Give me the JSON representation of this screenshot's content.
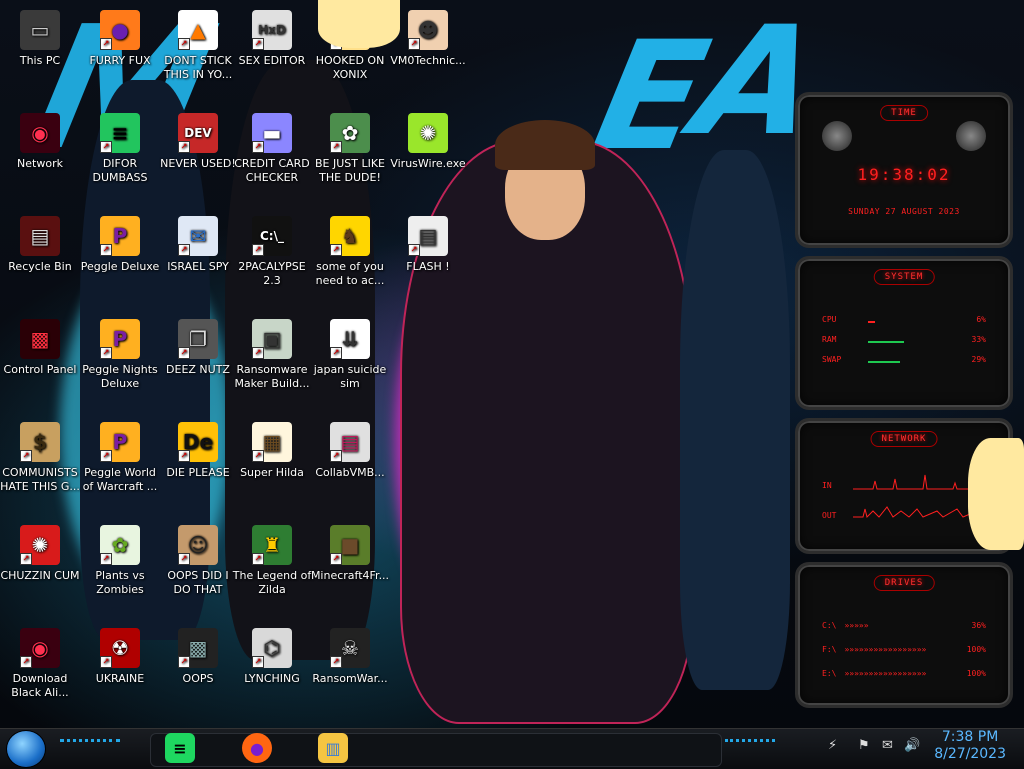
{
  "desktop": {
    "icons": [
      {
        "label": "This PC",
        "glyph": "▭",
        "color": "#3a3a3a",
        "fg": "#ccc",
        "shortcut": false
      },
      {
        "label": "FURRY FUX",
        "glyph": "●",
        "color": "#ff7a1a",
        "fg": "#6a1fb0",
        "shortcut": true
      },
      {
        "label": "DONT STICK THIS IN YO...",
        "glyph": "▲",
        "color": "#ffffff",
        "fg": "#ff7a00",
        "shortcut": true
      },
      {
        "label": "SEX EDITOR",
        "glyph": "HxD",
        "color": "#e0e0e0",
        "fg": "#333",
        "shortcut": true
      },
      {
        "label": "HOOKED ON XONIX",
        "glyph": "☺",
        "color": "#ffe08a",
        "fg": "#333",
        "shortcut": true
      },
      {
        "label": "VM0Technic...",
        "glyph": "☻",
        "color": "#f0d0b0",
        "fg": "#333",
        "shortcut": true
      },
      {
        "label": "Network",
        "glyph": "◉",
        "color": "#3a0010",
        "fg": "#ff3050",
        "shortcut": false
      },
      {
        "label": "DIFOR DUMBASS",
        "glyph": "≡",
        "color": "#22c55e",
        "fg": "#000",
        "shortcut": true
      },
      {
        "label": "NEVER USED!",
        "glyph": "DEV",
        "color": "#c62828",
        "fg": "#fff",
        "shortcut": true
      },
      {
        "label": "CREDIT CARD CHECKER",
        "glyph": "▬",
        "color": "#8b86ff",
        "fg": "#fff",
        "shortcut": true
      },
      {
        "label": "BE JUST LIKE THE DUDE!",
        "glyph": "✿",
        "color": "#4c8e4c",
        "fg": "#fff",
        "shortcut": true
      },
      {
        "label": "VirusWire.exe",
        "glyph": "✺",
        "color": "#9ae62b",
        "fg": "#fff",
        "shortcut": false
      },
      {
        "label": "Recycle Bin",
        "glyph": "▤",
        "color": "#5a1010",
        "fg": "#ddd",
        "shortcut": false
      },
      {
        "label": "Peggle Deluxe",
        "glyph": "P",
        "color": "#ffb020",
        "fg": "#7b1fa2",
        "shortcut": true
      },
      {
        "label": "ISRAEL SPY",
        "glyph": "✉",
        "color": "#dfe8f5",
        "fg": "#2a6ec8",
        "shortcut": true
      },
      {
        "label": "2PACALYPSE 2.3",
        "glyph": "C:\\_",
        "color": "#111",
        "fg": "#fff",
        "shortcut": true
      },
      {
        "label": "some of you need to ac...",
        "glyph": "♞",
        "color": "#ffd600",
        "fg": "#5d3a1a",
        "shortcut": true
      },
      {
        "label": "FLASH !",
        "glyph": "▤",
        "color": "#eeeeee",
        "fg": "#333",
        "shortcut": true
      },
      {
        "label": "Control Panel",
        "glyph": "▩",
        "color": "#2a0006",
        "fg": "#ff3040",
        "shortcut": false
      },
      {
        "label": "Peggle Nights Deluxe",
        "glyph": "P",
        "color": "#ffb020",
        "fg": "#7b1fa2",
        "shortcut": true
      },
      {
        "label": "DEEZ NUTZ",
        "glyph": "❐",
        "color": "#555",
        "fg": "#ddd",
        "shortcut": true
      },
      {
        "label": "Ransomware Maker Build...",
        "glyph": "▣",
        "color": "#c8d6c8",
        "fg": "#333",
        "shortcut": true
      },
      {
        "label": "japan suicide sim",
        "glyph": "⇊",
        "color": "#ffffff",
        "fg": "#333",
        "shortcut": true
      },
      {
        "label": "COMMUNISTS HATE THIS G...",
        "glyph": "$",
        "color": "#c8a060",
        "fg": "#3a2a10",
        "shortcut": true
      },
      {
        "label": "Peggle World of Warcraft ...",
        "glyph": "P",
        "color": "#ffb020",
        "fg": "#7b1fa2",
        "shortcut": true
      },
      {
        "label": "DIE PLEASE",
        "glyph": "De",
        "color": "#ffc107",
        "fg": "#111",
        "shortcut": true
      },
      {
        "label": "Super Hilda",
        "glyph": "▦",
        "color": "#fff6dd",
        "fg": "#6a4a20",
        "shortcut": true
      },
      {
        "label": "CollabVMB...",
        "glyph": "▤",
        "color": "#e0e0e0",
        "fg": "#c0185a",
        "shortcut": true
      },
      {
        "label": "CHUZZIN CUM",
        "glyph": "✺",
        "color": "#d81b1b",
        "fg": "#fff",
        "shortcut": true
      },
      {
        "label": "Plants vs Zombies",
        "glyph": "✿",
        "color": "#e8f5e0",
        "fg": "#6a2",
        "shortcut": true
      },
      {
        "label": "OOPS DID I DO THAT",
        "glyph": "☺",
        "color": "#c49a6c",
        "fg": "#222",
        "shortcut": true
      },
      {
        "label": "The Legend of Zilda",
        "glyph": "♜",
        "color": "#2e7d32",
        "fg": "#ffcc00",
        "shortcut": true
      },
      {
        "label": "Minecraft4Fr...",
        "glyph": "■",
        "color": "#5a7d2a",
        "fg": "#6b4a2a",
        "shortcut": true
      },
      {
        "label": "Download Black Ali...",
        "glyph": "◉",
        "color": "#3a0010",
        "fg": "#ff3050",
        "shortcut": true
      },
      {
        "label": "UKRAINE",
        "glyph": "☢",
        "color": "#b00000",
        "fg": "#fff",
        "shortcut": true
      },
      {
        "label": "OOPS",
        "glyph": "▩",
        "color": "#222",
        "fg": "#8aa",
        "shortcut": true
      },
      {
        "label": "LYNCHING",
        "glyph": "⌬",
        "color": "#d9d9d9",
        "fg": "#333",
        "shortcut": true
      },
      {
        "label": "RansomWar...",
        "glyph": "☠",
        "color": "#222",
        "fg": "#eee",
        "shortcut": true
      }
    ]
  },
  "gadgets": {
    "time": {
      "title": "TIME",
      "clock": "19:38:02",
      "date": "SUNDAY 27 AUGUST 2023"
    },
    "system": {
      "title": "SYSTEM",
      "rows": [
        {
          "label": "CPU",
          "value": "6%",
          "level": 0.06
        },
        {
          "label": "RAM",
          "value": "33%",
          "level": 0.33
        },
        {
          "label": "SWAP",
          "value": "29%",
          "level": 0.29
        }
      ]
    },
    "network": {
      "title": "NETWORK",
      "in_label": "IN",
      "out_label": "OUT"
    },
    "drives": {
      "title": "DRIVES",
      "rows": [
        {
          "label": "C:\\",
          "arrows": "»»»»»",
          "value": "36%"
        },
        {
          "label": "F:\\",
          "arrows": "»»»»»»»»»»»»»»»»»",
          "value": "100%"
        },
        {
          "label": "E:\\",
          "arrows": "»»»»»»»»»»»»»»»»»",
          "value": "100%"
        }
      ]
    }
  },
  "taskbar": {
    "pinned": [
      {
        "name": "spotify-icon",
        "glyph": "≡",
        "bg": "#1ed760",
        "fg": "#000"
      },
      {
        "name": "firefox-icon",
        "glyph": "●",
        "bg": "#ff6611",
        "fg": "#7a1fcf"
      },
      {
        "name": "file-explorer-icon",
        "glyph": "▥",
        "bg": "#f5c542",
        "fg": "#3a7bd5"
      }
    ],
    "tray": [
      "⚡",
      "⚑",
      "✉",
      "🔊"
    ],
    "time": "7:38 PM",
    "date": "8/27/2023"
  },
  "colors": {
    "gadget_red": "#ff2020",
    "clock_blue": "#5ab8ff",
    "wall_cyan": "#1fa6d8"
  }
}
